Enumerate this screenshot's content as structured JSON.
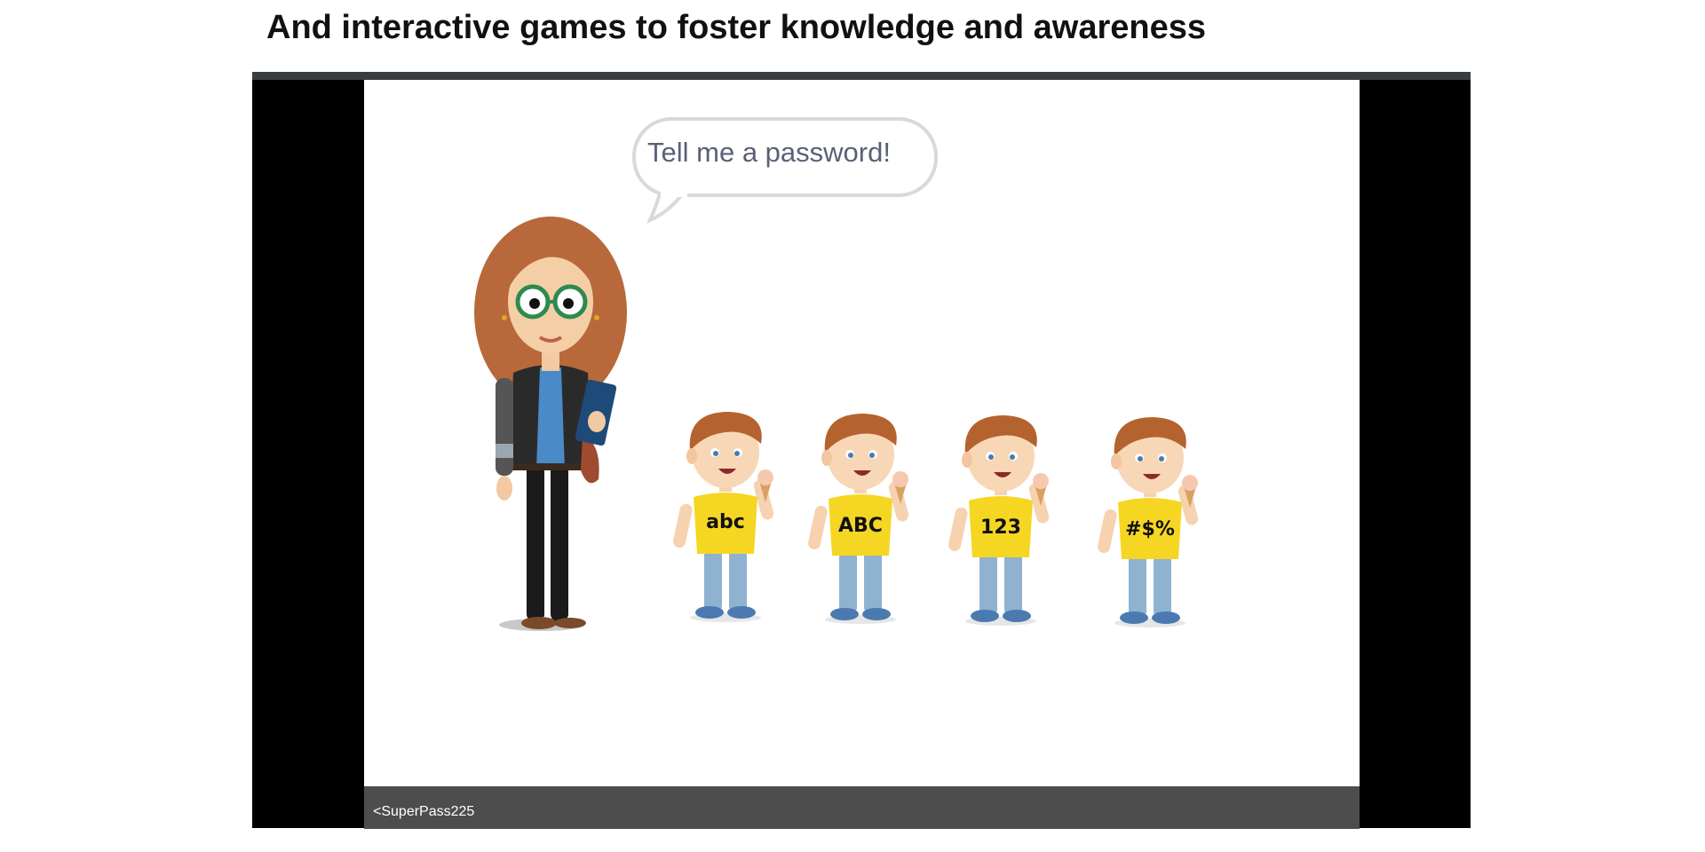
{
  "slide": {
    "title": "And interactive games to foster knowledge and awareness"
  },
  "game": {
    "speech_bubble": "Tell me a password!",
    "input_value": "<SuperPass225",
    "characters": [
      {
        "shirt_label": "abc"
      },
      {
        "shirt_label": "ABC"
      },
      {
        "shirt_label": "123"
      },
      {
        "shirt_label": "#$%"
      }
    ]
  },
  "colors": {
    "player_bg": "#000000",
    "stage_bg": "#ffffff",
    "bottom_bar": "#4d4d4d",
    "bubble_text": "#5a6078",
    "shirt": "#f5d623"
  }
}
